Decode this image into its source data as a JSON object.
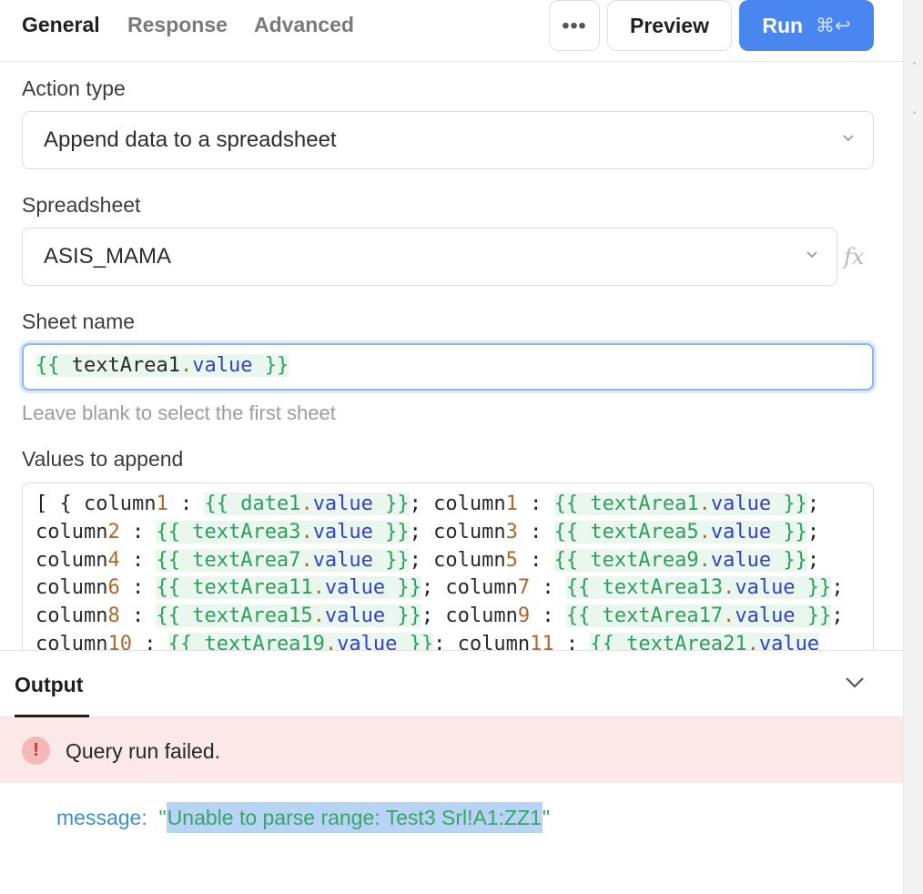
{
  "tabs": {
    "general": "General",
    "response": "Response",
    "advanced": "Advanced"
  },
  "toolbar": {
    "more_label": "•••",
    "preview_label": "Preview",
    "run_label": "Run",
    "run_shortcut": "⌘↩"
  },
  "form": {
    "action_type": {
      "label": "Action type",
      "value": "Append data to a spreadsheet"
    },
    "spreadsheet": {
      "label": "Spreadsheet",
      "value": "ASIS_MAMA",
      "fx": "fx"
    },
    "sheet_name": {
      "label": "Sheet name",
      "tpl_open": "{{ ",
      "var": "textArea1",
      "dot": ".",
      "prop": "value",
      "tpl_close": " }}",
      "hint": "Leave blank to select the first sheet"
    },
    "values": {
      "label": "Values to append",
      "lines": [
        "[ { column1 : {{ date1.value }}; column1 : {{ textArea1.value }};",
        "column2 : {{ textArea3.value }}; column3 : {{ textArea5.value }};",
        "column4 : {{ textArea7.value }}; column5 : {{ textArea9.value }};",
        "column6 : {{ textArea11.value }}; column7 : {{ textArea13.value }};",
        "column8 : {{ textArea15.value }}; column9 : {{ textArea17.value }};",
        "column10 : {{ textArea19.value }}; column11 : {{ textArea21.value"
      ]
    }
  },
  "output": {
    "tab_label": "Output",
    "error_icon": "!",
    "error_text": "Query run failed.",
    "message_key": "message:",
    "message_value": "Unable to parse range: Test3 Srl!A1:ZZ1"
  },
  "colors": {
    "accent": "#4a86ef",
    "error_bg": "#fbe9e9",
    "template_bg": "#e9f7ef",
    "template_fg": "#2f9e5d"
  }
}
